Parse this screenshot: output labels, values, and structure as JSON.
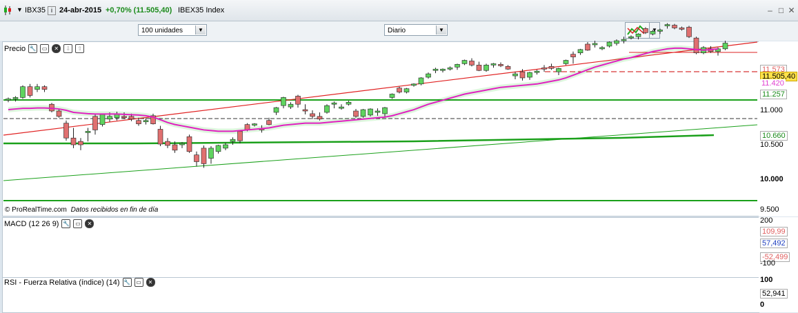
{
  "header": {
    "symbol": "IBX35",
    "date": "24-abr-2015",
    "change": "+0,70% (11.505,40)",
    "instrument": "IBEX35 Index"
  },
  "toolbar": {
    "quantity_select": "100 unidades",
    "period_select": "Diario"
  },
  "colors": {
    "up_candle": "#5fd35f",
    "down_candle": "#e07070",
    "ma_line": "#e020c0",
    "trendline_green": "#1aa01a",
    "trendline_red": "#e02020"
  },
  "price_panel": {
    "label": "Precio",
    "watermark": "© ProRealTime.com",
    "watermark_note": "Datos recibidos en fin de día",
    "axis_ticks": [
      "11.000",
      "10.500",
      "10.000",
      "9.500"
    ],
    "axis_tags": {
      "last": "11.505,40",
      "r1": "11.573",
      "r2": "11.420",
      "s1": "11.257",
      "s2": "10.660"
    }
  },
  "macd_panel": {
    "label": "MACD (12 26 9)",
    "axis_ticks": [
      "200",
      "-100"
    ],
    "axis_tags": {
      "t1": "109,99",
      "t2": "57,492",
      "t3": "-52,499"
    }
  },
  "rsi_panel": {
    "label": "RSI - Fuerza Relativa (índice) (14)",
    "axis_ticks": [
      "100",
      "0"
    ],
    "axis_tags": {
      "t1": "52,941"
    }
  },
  "chart_data": {
    "type": "candlestick",
    "ylim": [
      9500,
      11800
    ],
    "candles": [
      [
        10660,
        10700,
        10630,
        10680
      ],
      [
        10680,
        10720,
        10640,
        10700
      ],
      [
        10700,
        10880,
        10680,
        10860
      ],
      [
        10860,
        10900,
        10700,
        10730
      ],
      [
        10820,
        10900,
        10780,
        10860
      ],
      [
        10860,
        10880,
        10780,
        10820
      ],
      [
        10600,
        10620,
        10480,
        10500
      ],
      [
        10500,
        10520,
        10400,
        10420
      ],
      [
        10320,
        10360,
        10060,
        10100
      ],
      [
        10100,
        10250,
        9950,
        10000
      ],
      [
        10050,
        10100,
        9920,
        10000
      ],
      [
        10180,
        10250,
        10050,
        10200
      ],
      [
        10420,
        10450,
        10150,
        10220
      ],
      [
        10300,
        10460,
        10270,
        10450
      ],
      [
        10380,
        10480,
        10340,
        10420
      ],
      [
        10400,
        10490,
        10360,
        10460
      ],
      [
        10420,
        10480,
        10380,
        10400
      ],
      [
        10420,
        10460,
        10350,
        10380
      ],
      [
        10360,
        10400,
        10280,
        10310
      ],
      [
        10340,
        10390,
        10300,
        10360
      ],
      [
        10430,
        10460,
        10300,
        10310
      ],
      [
        10230,
        10280,
        9980,
        10010
      ],
      [
        10050,
        10100,
        9950,
        9990
      ],
      [
        10000,
        10050,
        9880,
        9920
      ],
      [
        10000,
        10040,
        9950,
        10020
      ],
      [
        10120,
        10150,
        9880,
        9900
      ],
      [
        9850,
        9900,
        9680,
        9750
      ],
      [
        9950,
        9990,
        9660,
        9720
      ],
      [
        9800,
        9980,
        9720,
        9950
      ],
      [
        9900,
        10000,
        9870,
        9990
      ],
      [
        9950,
        10030,
        9920,
        10000
      ],
      [
        10050,
        10110,
        10000,
        10080
      ],
      [
        10200,
        10220,
        10020,
        10060
      ],
      [
        10300,
        10320,
        10200,
        10220
      ],
      [
        10300,
        10320,
        10270,
        10310
      ],
      [
        10240,
        10290,
        10180,
        10220
      ],
      [
        10360,
        10400,
        10290,
        10300
      ],
      [
        10480,
        10560,
        10440,
        10550
      ],
      [
        10580,
        10710,
        10540,
        10700
      ],
      [
        10560,
        10630,
        10530,
        10600
      ],
      [
        10720,
        10740,
        10550,
        10600
      ],
      [
        10520,
        10600,
        10450,
        10500
      ],
      [
        10460,
        10510,
        10380,
        10420
      ],
      [
        10420,
        10480,
        10360,
        10380
      ],
      [
        10480,
        10600,
        10460,
        10580
      ],
      [
        10600,
        10640,
        10540,
        10620
      ],
      [
        10560,
        10600,
        10520,
        10560
      ],
      [
        10600,
        10650,
        10580,
        10630
      ],
      [
        10500,
        10530,
        10400,
        10420
      ],
      [
        10420,
        10530,
        10400,
        10520
      ],
      [
        10440,
        10540,
        10420,
        10530
      ],
      [
        10480,
        10540,
        10430,
        10500
      ],
      [
        10460,
        10560,
        10400,
        10550
      ],
      [
        10700,
        10760,
        10680,
        10750
      ],
      [
        10840,
        10860,
        10760,
        10780
      ],
      [
        10780,
        10840,
        10760,
        10830
      ],
      [
        10880,
        10910,
        10860,
        10900
      ],
      [
        10900,
        11000,
        10880,
        10990
      ],
      [
        11000,
        11070,
        10980,
        11050
      ],
      [
        11100,
        11140,
        11060,
        11120
      ],
      [
        11100,
        11130,
        11070,
        11120
      ],
      [
        11130,
        11160,
        11100,
        11140
      ],
      [
        11150,
        11200,
        11110,
        11190
      ],
      [
        11200,
        11260,
        11180,
        11250
      ],
      [
        11240,
        11280,
        11160,
        11180
      ],
      [
        11180,
        11230,
        11090,
        11100
      ],
      [
        11100,
        11200,
        11080,
        11180
      ],
      [
        11180,
        11210,
        11140,
        11200
      ],
      [
        11190,
        11220,
        11150,
        11170
      ],
      [
        11160,
        11180,
        11110,
        11120
      ],
      [
        11020,
        11080,
        10970,
        11050
      ],
      [
        11080,
        11120,
        10950,
        10990
      ],
      [
        11000,
        11080,
        10960,
        11070
      ],
      [
        11070,
        11110,
        11040,
        11090
      ],
      [
        11140,
        11180,
        11080,
        11120
      ],
      [
        11160,
        11200,
        11110,
        11130
      ],
      [
        11080,
        11140,
        11030,
        11130
      ],
      [
        11200,
        11260,
        11180,
        11250
      ],
      [
        11340,
        11380,
        11200,
        11300
      ],
      [
        11360,
        11420,
        11330,
        11410
      ],
      [
        11490,
        11520,
        11390,
        11400
      ],
      [
        11500,
        11540,
        11440,
        11500
      ],
      [
        11420,
        11460,
        11400,
        11440
      ],
      [
        11460,
        11530,
        11440,
        11520
      ],
      [
        11500,
        11560,
        11470,
        11540
      ],
      [
        11540,
        11600,
        11500,
        11560
      ],
      [
        11600,
        11620,
        11560,
        11600
      ],
      [
        11600,
        11650,
        11560,
        11640
      ],
      [
        11720,
        11740,
        11640,
        11660
      ],
      [
        11640,
        11700,
        11620,
        11680
      ],
      [
        11680,
        11720,
        11640,
        11700
      ],
      [
        11760,
        11800,
        11720,
        11780
      ],
      [
        11770,
        11790,
        11710,
        11730
      ],
      [
        11730,
        11750,
        11690,
        11720
      ],
      [
        11740,
        11760,
        11580,
        11600
      ],
      [
        11580,
        11600,
        11340,
        11360
      ],
      [
        11360,
        11460,
        11340,
        11440
      ],
      [
        11420,
        11460,
        11360,
        11380
      ],
      [
        11380,
        11440,
        11320,
        11420
      ],
      [
        11420,
        11540,
        11400,
        11505
      ]
    ],
    "moving_average": [
      10520,
      10530,
      10540,
      10540,
      10545,
      10545,
      10540,
      10530,
      10510,
      10480,
      10470,
      10460,
      10455,
      10455,
      10455,
      10455,
      10450,
      10445,
      10440,
      10430,
      10410,
      10370,
      10330,
      10300,
      10280,
      10260,
      10240,
      10220,
      10210,
      10200,
      10200,
      10200,
      10210,
      10220,
      10230,
      10240,
      10250,
      10270,
      10290,
      10300,
      10310,
      10320,
      10320,
      10320,
      10330,
      10340,
      10350,
      10360,
      10370,
      10380,
      10390,
      10400,
      10410,
      10430,
      10460,
      10490,
      10520,
      10560,
      10600,
      10630,
      10660,
      10690,
      10720,
      10750,
      10770,
      10790,
      10810,
      10830,
      10850,
      10860,
      10870,
      10880,
      10890,
      10900,
      10920,
      10940,
      10960,
      10990,
      11030,
      11070,
      11110,
      11150,
      11180,
      11210,
      11240,
      11270,
      11290,
      11320,
      11350,
      11380,
      11400,
      11420,
      11430,
      11430,
      11420,
      11410,
      11400,
      11410,
      11420
    ]
  }
}
